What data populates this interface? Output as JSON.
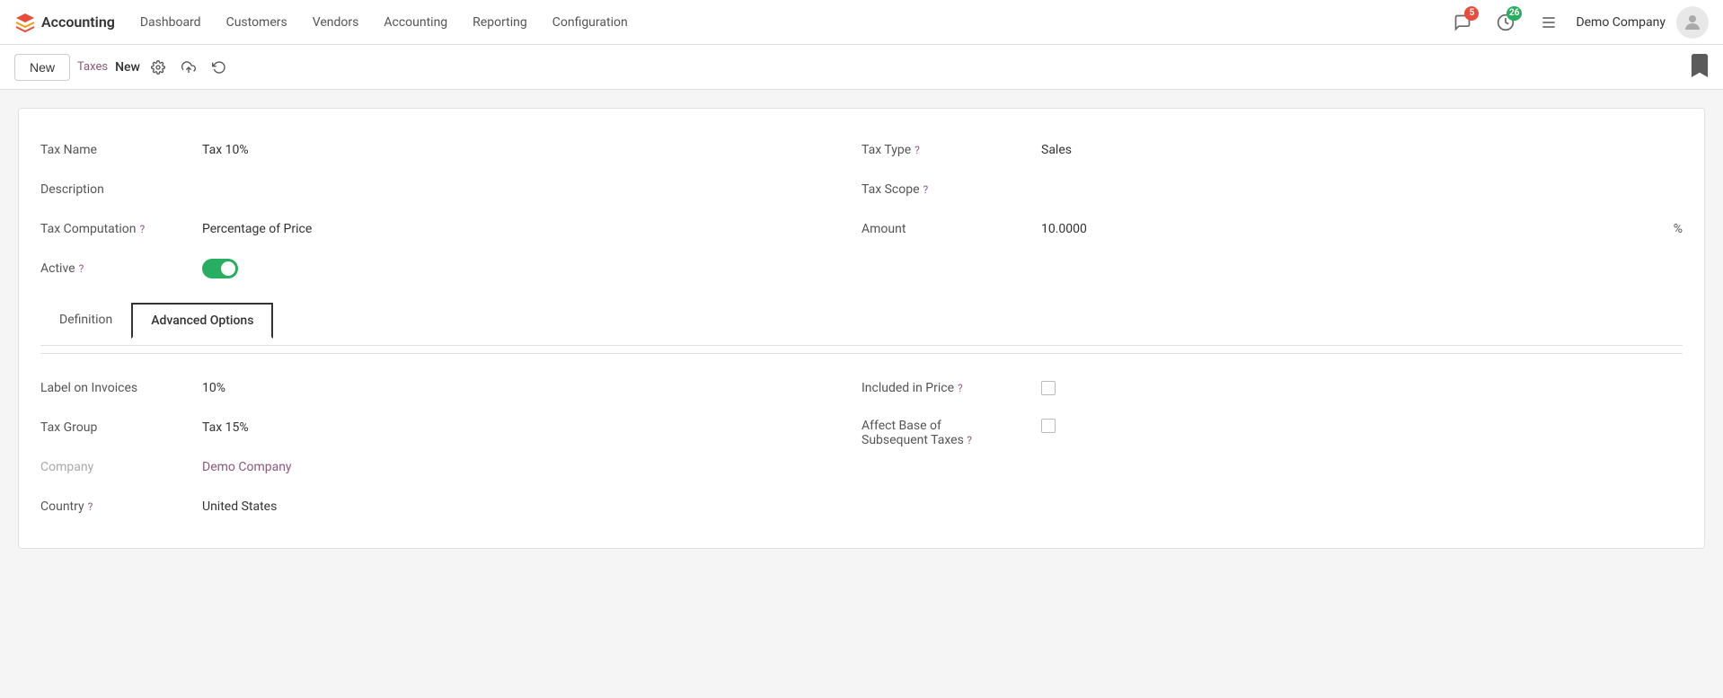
{
  "app": {
    "name": "Accounting",
    "logo_color": "#e74c3c"
  },
  "topnav": {
    "links": [
      "Dashboard",
      "Customers",
      "Vendors",
      "Accounting",
      "Reporting",
      "Configuration"
    ],
    "notifications_count": "5",
    "clock_count": "26",
    "company": "Demo Company"
  },
  "toolbar": {
    "breadcrumb": "Taxes",
    "new_label": "New",
    "record_label": "New"
  },
  "form": {
    "tax_name_label": "Tax Name",
    "tax_name_value": "Tax 10%",
    "description_label": "Description",
    "description_value": "",
    "tax_computation_label": "Tax Computation",
    "tax_computation_help": "?",
    "tax_computation_value": "Percentage of Price",
    "active_label": "Active",
    "active_help": "?",
    "tax_type_label": "Tax Type",
    "tax_type_help": "?",
    "tax_type_value": "Sales",
    "tax_scope_label": "Tax Scope",
    "tax_scope_help": "?",
    "tax_scope_value": "",
    "amount_label": "Amount",
    "amount_value": "10.0000",
    "amount_unit": "%"
  },
  "tabs": {
    "definition_label": "Definition",
    "advanced_label": "Advanced Options"
  },
  "advanced": {
    "label_on_invoices_label": "Label on Invoices",
    "label_on_invoices_value": "10%",
    "tax_group_label": "Tax Group",
    "tax_group_value": "Tax 15%",
    "company_label": "Company",
    "company_value": "Demo Company",
    "country_label": "Country",
    "country_help": "?",
    "country_value": "United States",
    "included_in_price_label": "Included in Price",
    "included_in_price_help": "?",
    "affect_base_label": "Affect Base of",
    "affect_base_label2": "Subsequent Taxes",
    "affect_base_help": "?"
  },
  "icons": {
    "chat": "💬",
    "clock": "🕐",
    "wrench": "✂",
    "gear": "⚙",
    "upload": "☁",
    "undo": "↺",
    "bookmark": "🔖",
    "avatar": "👤"
  }
}
